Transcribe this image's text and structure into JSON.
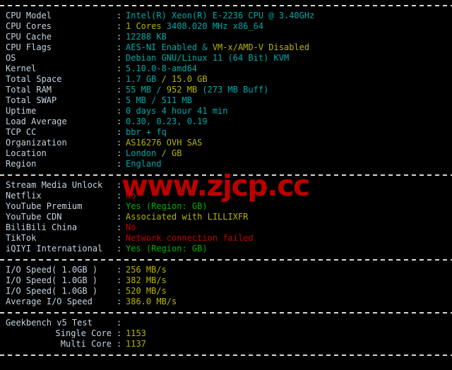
{
  "terminal": {
    "background": "#000000",
    "label_color": "#c3d4e2",
    "cyan": "#00a8a8",
    "yellow": "#b5b500",
    "green": "#00b200",
    "red": "#c10000",
    "separator": "----------------------------------------------------------------"
  },
  "watermark": {
    "text": "www.zjcp.cc",
    "color": "#bb0000"
  },
  "system_info": {
    "rows": [
      {
        "label": "CPU Model",
        "colon": ":",
        "parts": [
          {
            "text": "Intel(R) Xeon(R) E-2236 CPU @ 3.40GHz",
            "color": "cyan"
          }
        ]
      },
      {
        "label": "CPU Cores",
        "colon": ":",
        "parts": [
          {
            "text": "1 Cores ",
            "color": "yellow"
          },
          {
            "text": "3408.020 MHz x86_64",
            "color": "cyan"
          }
        ]
      },
      {
        "label": "CPU Cache",
        "colon": ":",
        "parts": [
          {
            "text": "12288 KB",
            "color": "cyan"
          }
        ]
      },
      {
        "label": "CPU Flags",
        "colon": ":",
        "parts": [
          {
            "text": "AES-NI Enabled & ",
            "color": "cyan"
          },
          {
            "text": "VM-x/AMD-V Disabled",
            "color": "yellow"
          }
        ]
      },
      {
        "label": "OS",
        "colon": ":",
        "parts": [
          {
            "text": "Debian GNU/Linux 11 (64 Bit) KVM",
            "color": "cyan"
          }
        ]
      },
      {
        "label": "Kernel",
        "colon": ":",
        "parts": [
          {
            "text": "5.10.0-8-amd64",
            "color": "cyan"
          }
        ]
      },
      {
        "label": "Total Space",
        "colon": ":",
        "parts": [
          {
            "text": "1.7 GB ",
            "color": "cyan"
          },
          {
            "text": "/ 15.0 GB",
            "color": "yellow"
          }
        ]
      },
      {
        "label": "Total RAM",
        "colon": ":",
        "parts": [
          {
            "text": "55 MB / ",
            "color": "cyan"
          },
          {
            "text": "952 MB ",
            "color": "yellow"
          },
          {
            "text": "(273 MB Buff)",
            "color": "cyan"
          }
        ]
      },
      {
        "label": "Total SWAP",
        "colon": ":",
        "parts": [
          {
            "text": "5 MB / 511 MB",
            "color": "cyan"
          }
        ]
      },
      {
        "label": "Uptime",
        "colon": ":",
        "parts": [
          {
            "text": "0 days 4 hour 41 min",
            "color": "cyan"
          }
        ]
      },
      {
        "label": "Load Average",
        "colon": ":",
        "parts": [
          {
            "text": "0.30, 0.23, 0.19",
            "color": "cyan"
          }
        ]
      },
      {
        "label": "TCP CC",
        "colon": ":",
        "parts": [
          {
            "text": "bbr + fq",
            "color": "cyan"
          }
        ]
      },
      {
        "label": "Organization",
        "colon": ":",
        "parts": [
          {
            "text": "AS16276 OVH SAS",
            "color": "yellow"
          }
        ]
      },
      {
        "label": "Location",
        "colon": ":",
        "parts": [
          {
            "text": "London ",
            "color": "cyan"
          },
          {
            "text": "/ GB",
            "color": "yellow"
          }
        ]
      },
      {
        "label": "Region",
        "colon": ":",
        "parts": [
          {
            "text": "England",
            "color": "cyan"
          }
        ]
      }
    ]
  },
  "stream_unlock": {
    "rows": [
      {
        "label": "Stream Media Unlock",
        "colon": ":",
        "parts": []
      },
      {
        "label": "Netflix",
        "colon": ":",
        "parts": [
          {
            "text": "No",
            "color": "red"
          }
        ]
      },
      {
        "label": "YouTube Premium",
        "colon": ":",
        "parts": [
          {
            "text": "Yes (Region: GB)",
            "color": "green"
          }
        ]
      },
      {
        "label": "YouTube CDN",
        "colon": ":",
        "parts": [
          {
            "text": "Associated with LILLIXFR",
            "color": "yellow"
          }
        ]
      },
      {
        "label": "BiliBili China",
        "colon": ":",
        "parts": [
          {
            "text": "No",
            "color": "red"
          }
        ]
      },
      {
        "label": "TikTok",
        "colon": ":",
        "parts": [
          {
            "text": "Network connection failed",
            "color": "red"
          }
        ]
      },
      {
        "label": "iQIYI International",
        "colon": ":",
        "parts": [
          {
            "text": "Yes (Region: GB)",
            "color": "green"
          }
        ]
      }
    ]
  },
  "io_speed": {
    "rows": [
      {
        "label": "I/O Speed( 1.0GB )",
        "colon": ":",
        "parts": [
          {
            "text": "256 MB/s",
            "color": "yellow"
          }
        ]
      },
      {
        "label": "I/O Speed( 1.0GB )",
        "colon": ":",
        "parts": [
          {
            "text": "382 MB/s",
            "color": "yellow"
          }
        ]
      },
      {
        "label": "I/O Speed( 1.0GB )",
        "colon": ":",
        "parts": [
          {
            "text": "520 MB/s",
            "color": "yellow"
          }
        ]
      },
      {
        "label": "Average I/O Speed",
        "colon": ":",
        "parts": [
          {
            "text": "386.0 MB/s",
            "color": "yellow"
          }
        ]
      }
    ]
  },
  "geekbench": {
    "rows": [
      {
        "label": "Geekbench v5 Test",
        "colon": ":",
        "indent": false,
        "parts": []
      },
      {
        "label": "Single Core",
        "colon": ":",
        "indent": true,
        "parts": [
          {
            "text": "1153",
            "color": "yellow"
          }
        ]
      },
      {
        "label": "Multi Core",
        "colon": ":",
        "indent": true,
        "parts": [
          {
            "text": "1137",
            "color": "yellow"
          }
        ]
      }
    ]
  }
}
